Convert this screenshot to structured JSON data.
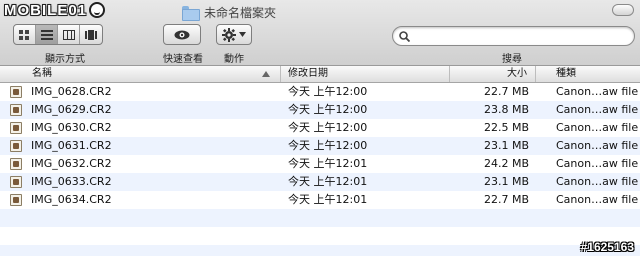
{
  "logo_text": "MOBILE01",
  "window": {
    "title": "未命名檔案夾"
  },
  "toolbar": {
    "view_label": "顯示方式",
    "quicklook_label": "快速查看",
    "action_label": "動作",
    "search_label": "搜尋",
    "search_placeholder": ""
  },
  "columns": {
    "name": "名稱",
    "date": "修改日期",
    "size": "大小",
    "kind": "種類"
  },
  "files": [
    {
      "name": "IMG_0628.CR2",
      "date": "今天 上午12:00",
      "size": "22.7 MB",
      "kind": "Canon…aw file"
    },
    {
      "name": "IMG_0629.CR2",
      "date": "今天 上午12:00",
      "size": "23.8 MB",
      "kind": "Canon…aw file"
    },
    {
      "name": "IMG_0630.CR2",
      "date": "今天 上午12:00",
      "size": "22.5 MB",
      "kind": "Canon…aw file"
    },
    {
      "name": "IMG_0631.CR2",
      "date": "今天 上午12:00",
      "size": "23.1 MB",
      "kind": "Canon…aw file"
    },
    {
      "name": "IMG_0632.CR2",
      "date": "今天 上午12:01",
      "size": "24.2 MB",
      "kind": "Canon…aw file"
    },
    {
      "name": "IMG_0633.CR2",
      "date": "今天 上午12:01",
      "size": "23.1 MB",
      "kind": "Canon…aw file"
    },
    {
      "name": "IMG_0634.CR2",
      "date": "今天 上午12:01",
      "size": "22.7 MB",
      "kind": "Canon…aw file"
    }
  ],
  "watermark": "#1625163",
  "colors": {
    "row_alt": "#edf3fe",
    "toolbar_top": "#e8e8e8",
    "toolbar_bottom": "#cfcfcf"
  },
  "icons": [
    "folder-icon",
    "icon-view-icon",
    "list-view-icon",
    "column-view-icon",
    "coverflow-view-icon",
    "eye-icon",
    "gear-icon",
    "search-icon",
    "raw-file-icon"
  ]
}
